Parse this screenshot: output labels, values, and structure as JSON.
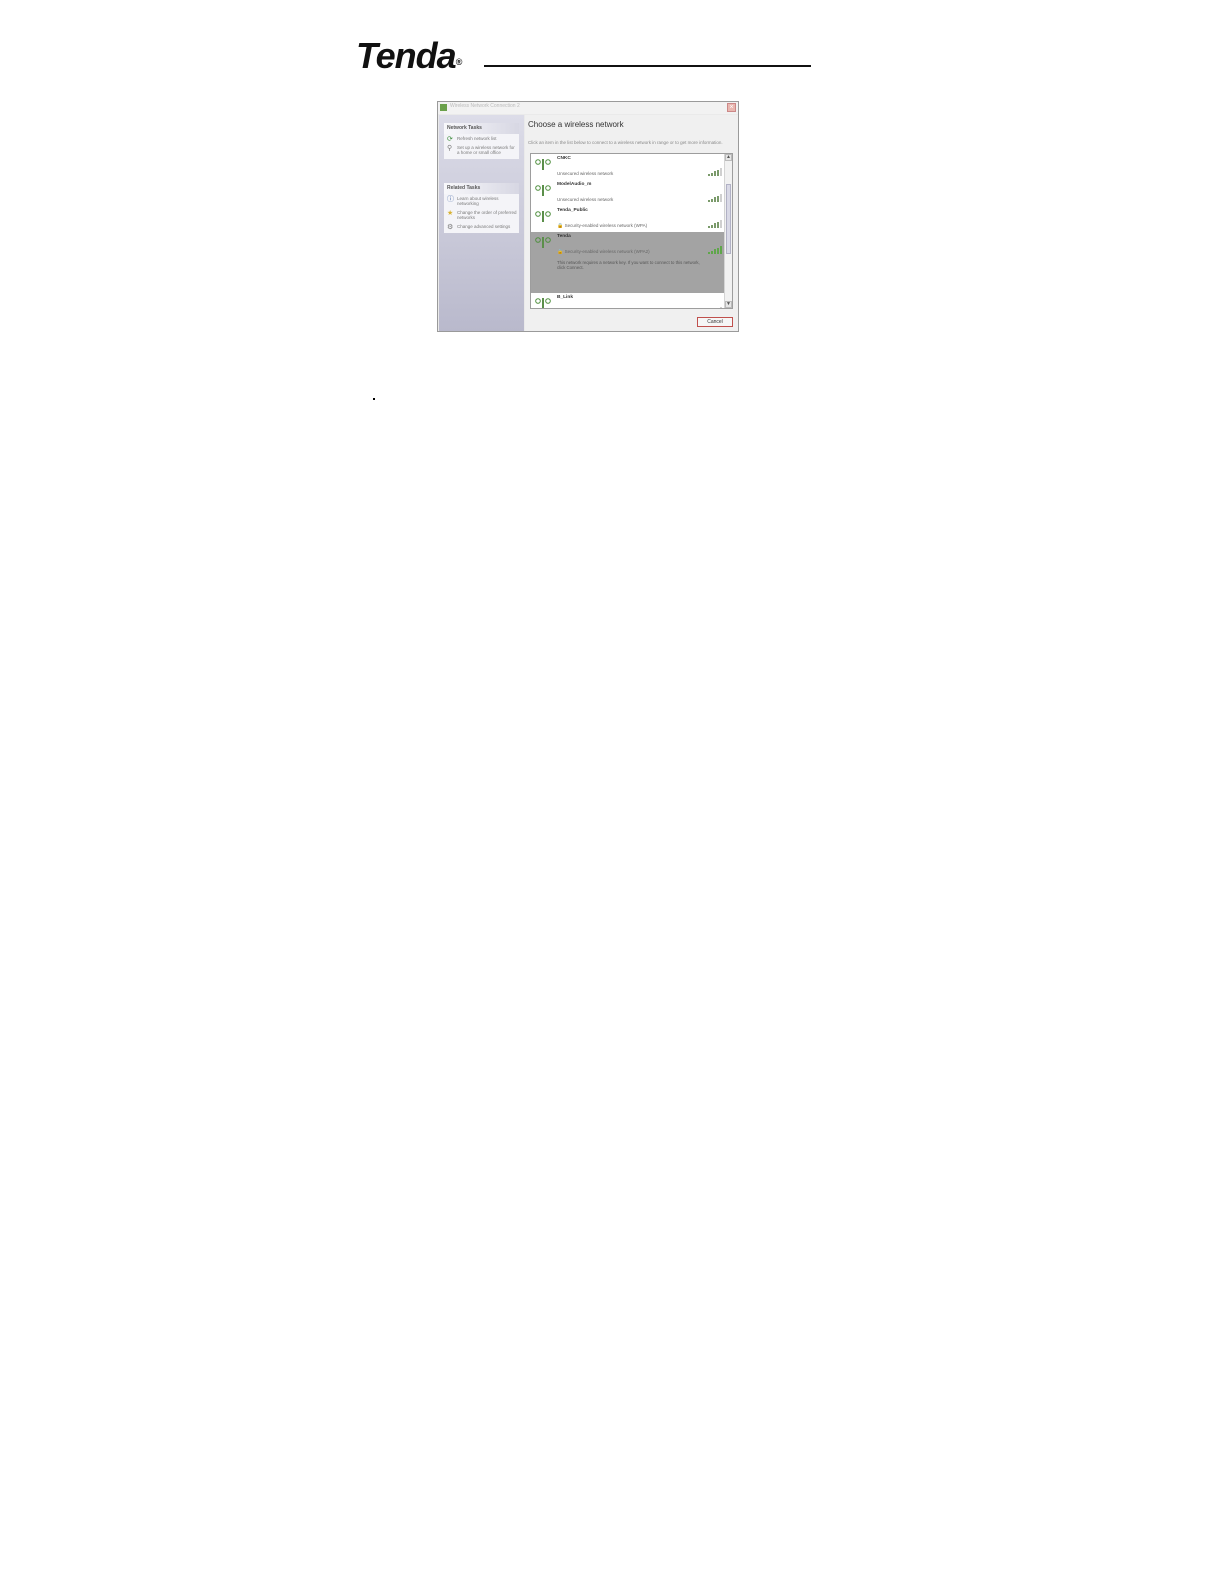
{
  "header": {
    "logo_text": "Tenda",
    "logo_mark": "®"
  },
  "window": {
    "title": "Wireless Network Connection 2",
    "close_label": "×",
    "network_tasks": {
      "heading": "Network Tasks",
      "items": [
        {
          "label": "Refresh network list",
          "icon": "refresh-icon"
        },
        {
          "label": "Set up a wireless network for a home or small office",
          "icon": "setup-network-icon"
        }
      ]
    },
    "related_tasks": {
      "heading": "Related Tasks",
      "items": [
        {
          "label": "Learn about wireless networking",
          "icon": "info-icon"
        },
        {
          "label": "Change the order of preferred networks",
          "icon": "star-icon"
        },
        {
          "label": "Change advanced settings",
          "icon": "settings-icon"
        }
      ]
    },
    "main": {
      "title": "Choose a wireless network",
      "description": "Click an item in the list below to connect to a wireless network in range or to get more information."
    },
    "networks": [
      {
        "name": "CNKC",
        "status": "Unsecured wireless network",
        "signal": 4,
        "secured": false
      },
      {
        "name": "ModelAudio_m",
        "status": "Unsecured wireless network",
        "signal": 4,
        "secured": false
      },
      {
        "name": "Tenda_Public",
        "status": "Security-enabled wireless network (WPA)",
        "signal": 4,
        "secured": true
      },
      {
        "name": "Tenda",
        "status": "Security-enabled wireless network (WPA2)",
        "signal": 5,
        "secured": true,
        "selected": true,
        "message": "This network requires a network key. If you want to connect to this network, click Connect."
      },
      {
        "name": "B_Link",
        "status": "",
        "signal": 4,
        "secured": false
      }
    ],
    "scroll_up": "▲",
    "scroll_down": "▼",
    "cancel_label": "Cancel",
    "colors": {
      "selection": "#a3a3a3",
      "signal": "#5fa64a",
      "cancel_border": "#c0504d"
    }
  }
}
